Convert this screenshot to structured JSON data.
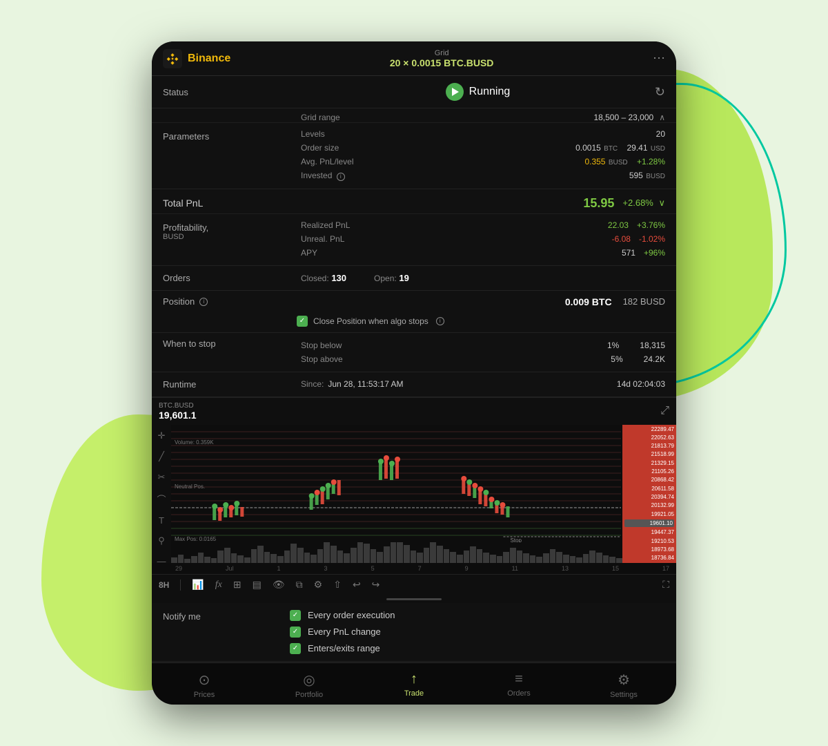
{
  "app": {
    "brand": "Binance",
    "exchange": "Binance",
    "grid_label": "Grid",
    "grid_value": "20 × 0.0015 BTC.BUSD"
  },
  "status": {
    "label": "Status",
    "value": "Running"
  },
  "parameters": {
    "label": "Parameters",
    "grid_range_key": "Grid range",
    "grid_range_val": "18,500 – 23,000",
    "levels_key": "Levels",
    "levels_val": "20",
    "order_size_key": "Order size",
    "order_size_btc": "0.0015",
    "order_size_btc_unit": "BTC",
    "order_size_usd": "29.41",
    "order_size_usd_unit": "USD",
    "avg_pnl_key": "Avg. PnL/level",
    "avg_pnl_val": "0.355",
    "avg_pnl_unit": "BUSD",
    "avg_pnl_pct": "+1.28%",
    "invested_key": "Invested",
    "invested_val": "595",
    "invested_unit": "BUSD"
  },
  "profitability": {
    "label": "Profitability,",
    "unit": "BUSD",
    "total_pnl_label": "Total PnL",
    "total_pnl_val": "15.95",
    "total_pnl_pct": "+2.68%",
    "realized_pnl_key": "Realized PnL",
    "realized_pnl_val": "22.03",
    "realized_pnl_pct": "+3.76%",
    "unreal_pnl_key": "Unreal. PnL",
    "unreal_pnl_val": "-6.08",
    "unreal_pnl_pct": "-1.02%",
    "apy_key": "APY",
    "apy_val": "571",
    "apy_pct": "+96%"
  },
  "orders": {
    "label": "Orders",
    "closed_label": "Closed:",
    "closed_val": "130",
    "open_label": "Open:",
    "open_val": "19"
  },
  "position": {
    "label": "Position",
    "btc_val": "0.009 BTC",
    "busd_val": "182 BUSD",
    "close_position_text": "Close Position when algo stops"
  },
  "when_to_stop": {
    "label": "When to stop",
    "stop_below_key": "Stop below",
    "stop_below_pct": "1%",
    "stop_below_val": "18,315",
    "stop_above_key": "Stop above",
    "stop_above_pct": "5%",
    "stop_above_val": "24.2K"
  },
  "runtime": {
    "label": "Runtime",
    "since_label": "Since:",
    "since_val": "Jun 28, 11:53:17 AM",
    "duration": "14d 02:04:03"
  },
  "chart": {
    "symbol": "BTC.BUSD",
    "price": "19,601.1",
    "timeframe": "8H",
    "x_labels": [
      "29",
      "Jul",
      "1",
      "3",
      "5",
      "7",
      "9",
      "11",
      "13",
      "15",
      "17"
    ],
    "price_ticks": [
      "22289.47",
      "22052.63",
      "21813.79",
      "21518.99",
      "21329.15",
      "21105.26",
      "20868.42",
      "20611.58",
      "20394.74",
      "20132.99",
      "19921.05",
      "19601.10",
      "19447.37",
      "19210.53",
      "18973.68",
      "18736.84"
    ],
    "volume_label": "Volume: 0.359K",
    "max_pos_label": "Max Pos: 0.0165",
    "neutral_pos_label": "Neutral Pos"
  },
  "notify": {
    "label": "Notify me",
    "items": [
      {
        "text": "Every order execution",
        "checked": true
      },
      {
        "text": "Every PnL change",
        "checked": true
      },
      {
        "text": "Enters/exits range",
        "checked": true
      }
    ]
  },
  "bottom_nav": {
    "items": [
      {
        "label": "Prices",
        "icon": "⊙",
        "active": false
      },
      {
        "label": "Portfolio",
        "icon": "◎",
        "active": false
      },
      {
        "label": "Trade",
        "icon": "↑",
        "active": true
      },
      {
        "label": "Orders",
        "icon": "≡",
        "active": false
      },
      {
        "label": "Settings",
        "icon": "⚙",
        "active": false
      }
    ]
  }
}
